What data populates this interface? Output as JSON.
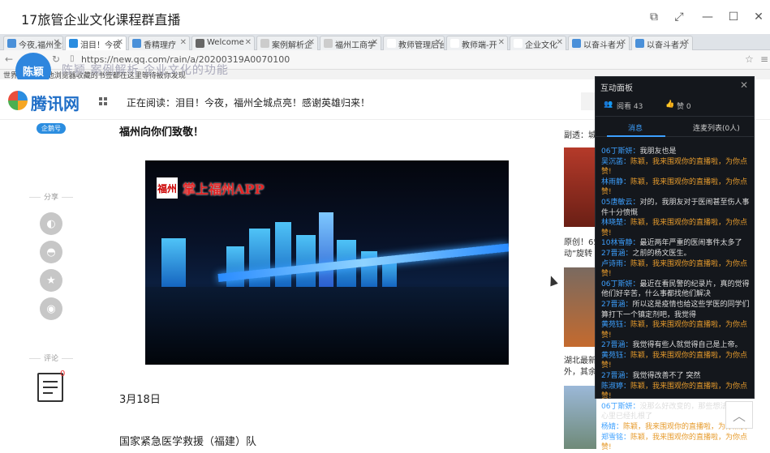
{
  "window": {
    "title": "17旅管企业文化课程群直播"
  },
  "browser": {
    "tabs": [
      {
        "label": "今夜,福州全城点亮"
      },
      {
        "label": "泪目！今夜"
      },
      {
        "label": "香精理疗"
      },
      {
        "label": "Welcome"
      },
      {
        "label": "案例解析企"
      },
      {
        "label": "福州工商学"
      },
      {
        "label": "教师管理后台"
      },
      {
        "label": "教师端-开"
      },
      {
        "label": "企业文化"
      },
      {
        "label": "以奋斗者为"
      },
      {
        "label": "以奋斗者为"
      }
    ],
    "url": "https://new.qq.com/rain/a/20200319A0070100",
    "bookmarks": "世界之大 | 其他浏览器收藏的书签都在这里等待被你发现"
  },
  "presenter": {
    "name": "陈颖",
    "caption": "陈颖 案例解析 企业文化的功能"
  },
  "site": {
    "logo_text": "腾讯网",
    "reading_label": "正在阅读：泪目！今夜，福州全城点亮！感谢英雄归来！",
    "badge": "企鹅号",
    "share_label": "分享",
    "comment_label": "评论",
    "comment_count": "0",
    "article_heading": "福州向你们致敬！",
    "photo_brand_mark": "福州",
    "photo_brand_text": "掌上福州APP",
    "date": "3月18日",
    "paragraph": "国家紧急医学救援（福建）队",
    "side": {
      "top": "副透：城",
      "caption1": "原创！65",
      "caption2": "动”旋转",
      "caption3": "湖北最新",
      "caption4": "外，其余"
    }
  },
  "interaction_panel": {
    "title": "互动面板",
    "views_label": "阅看 43",
    "likes_label": "赞 0",
    "tab_messages": "消息",
    "tab_mic": "连麦列表(0人)",
    "messages": [
      {
        "name": "06丁斯妍：",
        "text": "我朋友也是",
        "sys": false
      },
      {
        "name": "吴沉菡：",
        "text": "陈颖，我来围观你的直播啦，为你点赞!",
        "sys": true
      },
      {
        "name": "林雨静：",
        "text": "陈颖，我来围观你的直播啦，为你点赞!",
        "sys": true
      },
      {
        "name": "05唐敏云：",
        "text": "对的，我朋友对于医闹甚至伤人事件十分愤慨",
        "sys": false
      },
      {
        "name": "林晓楚：",
        "text": "陈颖，我来围观你的直播啦，为你点赞!",
        "sys": true
      },
      {
        "name": "10林雪静：",
        "text": "最近两年严重的医闹事件太多了",
        "sys": false
      },
      {
        "name": "27晋涵：",
        "text": "之前的杨文医生。",
        "sys": false
      },
      {
        "name": "卢诗雨：",
        "text": "陈颖，我来围观你的直播啦，为你点赞!",
        "sys": true
      },
      {
        "name": "06丁斯妍：",
        "text": "最近在看民警的纪录片，真的觉得他们好辛苦，什么事都找他们解决",
        "sys": false
      },
      {
        "name": "27晋涵：",
        "text": "所以这是疫情也给这些学医的同学们算打下一个镇定剂吧，我觉得",
        "sys": false
      },
      {
        "name": "黄苑钰：",
        "text": "陈颖，我来围观你的直播啦，为你点赞!",
        "sys": true
      },
      {
        "name": "27晋涵：",
        "text": "我觉得有些人就觉得自己是上帝。",
        "sys": false
      },
      {
        "name": "黄苑钰：",
        "text": "陈颖，我来围观你的直播啦，为你点赞!",
        "sys": true
      },
      {
        "name": "27晋涵：",
        "text": "我觉得改善不了 突然",
        "sys": false
      },
      {
        "name": "陈淑婷：",
        "text": "陈颖，我来围观你的直播啦，为你点赞!",
        "sys": true
      },
      {
        "name": "06丁斯妍：",
        "text": "没那么好改变的，那些想法在他们心里已经扎根了",
        "sys": false
      },
      {
        "name": "杨婧：",
        "text": "陈颖，我来围观你的直播啦，为你点赞!",
        "sys": true
      },
      {
        "name": "郑雪铭：",
        "text": "陈颖，我来围观你的直播啦，为你点赞!",
        "sys": true
      }
    ]
  }
}
